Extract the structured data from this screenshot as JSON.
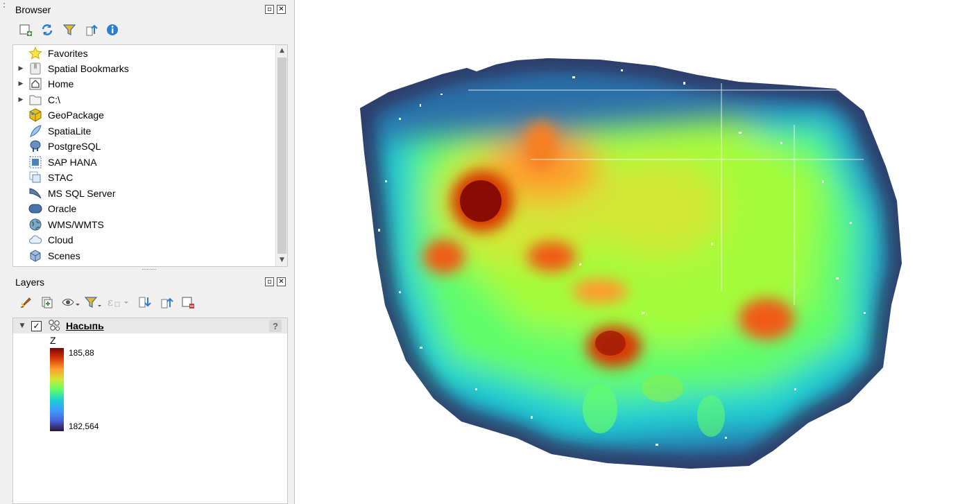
{
  "browser": {
    "title": "Browser",
    "items": [
      {
        "label": "Favorites",
        "icon": "star-icon",
        "expandable": false
      },
      {
        "label": "Spatial Bookmarks",
        "icon": "bookmark-icon",
        "expandable": true
      },
      {
        "label": "Home",
        "icon": "home-icon",
        "expandable": true
      },
      {
        "label": "C:\\",
        "icon": "folder-icon",
        "expandable": true
      },
      {
        "label": "GeoPackage",
        "icon": "geopackage-icon",
        "expandable": false
      },
      {
        "label": "SpatiaLite",
        "icon": "spatialite-icon",
        "expandable": false
      },
      {
        "label": "PostgreSQL",
        "icon": "postgresql-icon",
        "expandable": false
      },
      {
        "label": "SAP HANA",
        "icon": "sap-hana-icon",
        "expandable": false
      },
      {
        "label": "STAC",
        "icon": "stac-icon",
        "expandable": false
      },
      {
        "label": "MS SQL Server",
        "icon": "mssql-icon",
        "expandable": false
      },
      {
        "label": "Oracle",
        "icon": "oracle-icon",
        "expandable": false
      },
      {
        "label": "WMS/WMTS",
        "icon": "globe-icon",
        "expandable": false
      },
      {
        "label": "Cloud",
        "icon": "cloud-icon",
        "expandable": false
      },
      {
        "label": "Scenes",
        "icon": "cube-icon",
        "expandable": false
      }
    ]
  },
  "layers": {
    "title": "Layers",
    "layer_name": "Насыпь",
    "checked": true,
    "legend": {
      "attribute": "Z",
      "max": "185,88",
      "min": "182,564",
      "ramp_colors": [
        "#7a0403",
        "#d93806",
        "#fe9b2d",
        "#d1e834",
        "#62fc6b",
        "#1bcfd4",
        "#3e9bfe",
        "#4662d7",
        "#30123b"
      ]
    }
  },
  "colors": {
    "panel_bg": "#f0f0f0",
    "map_bg": "#ffffff",
    "tree_bg": "#ffffff"
  }
}
